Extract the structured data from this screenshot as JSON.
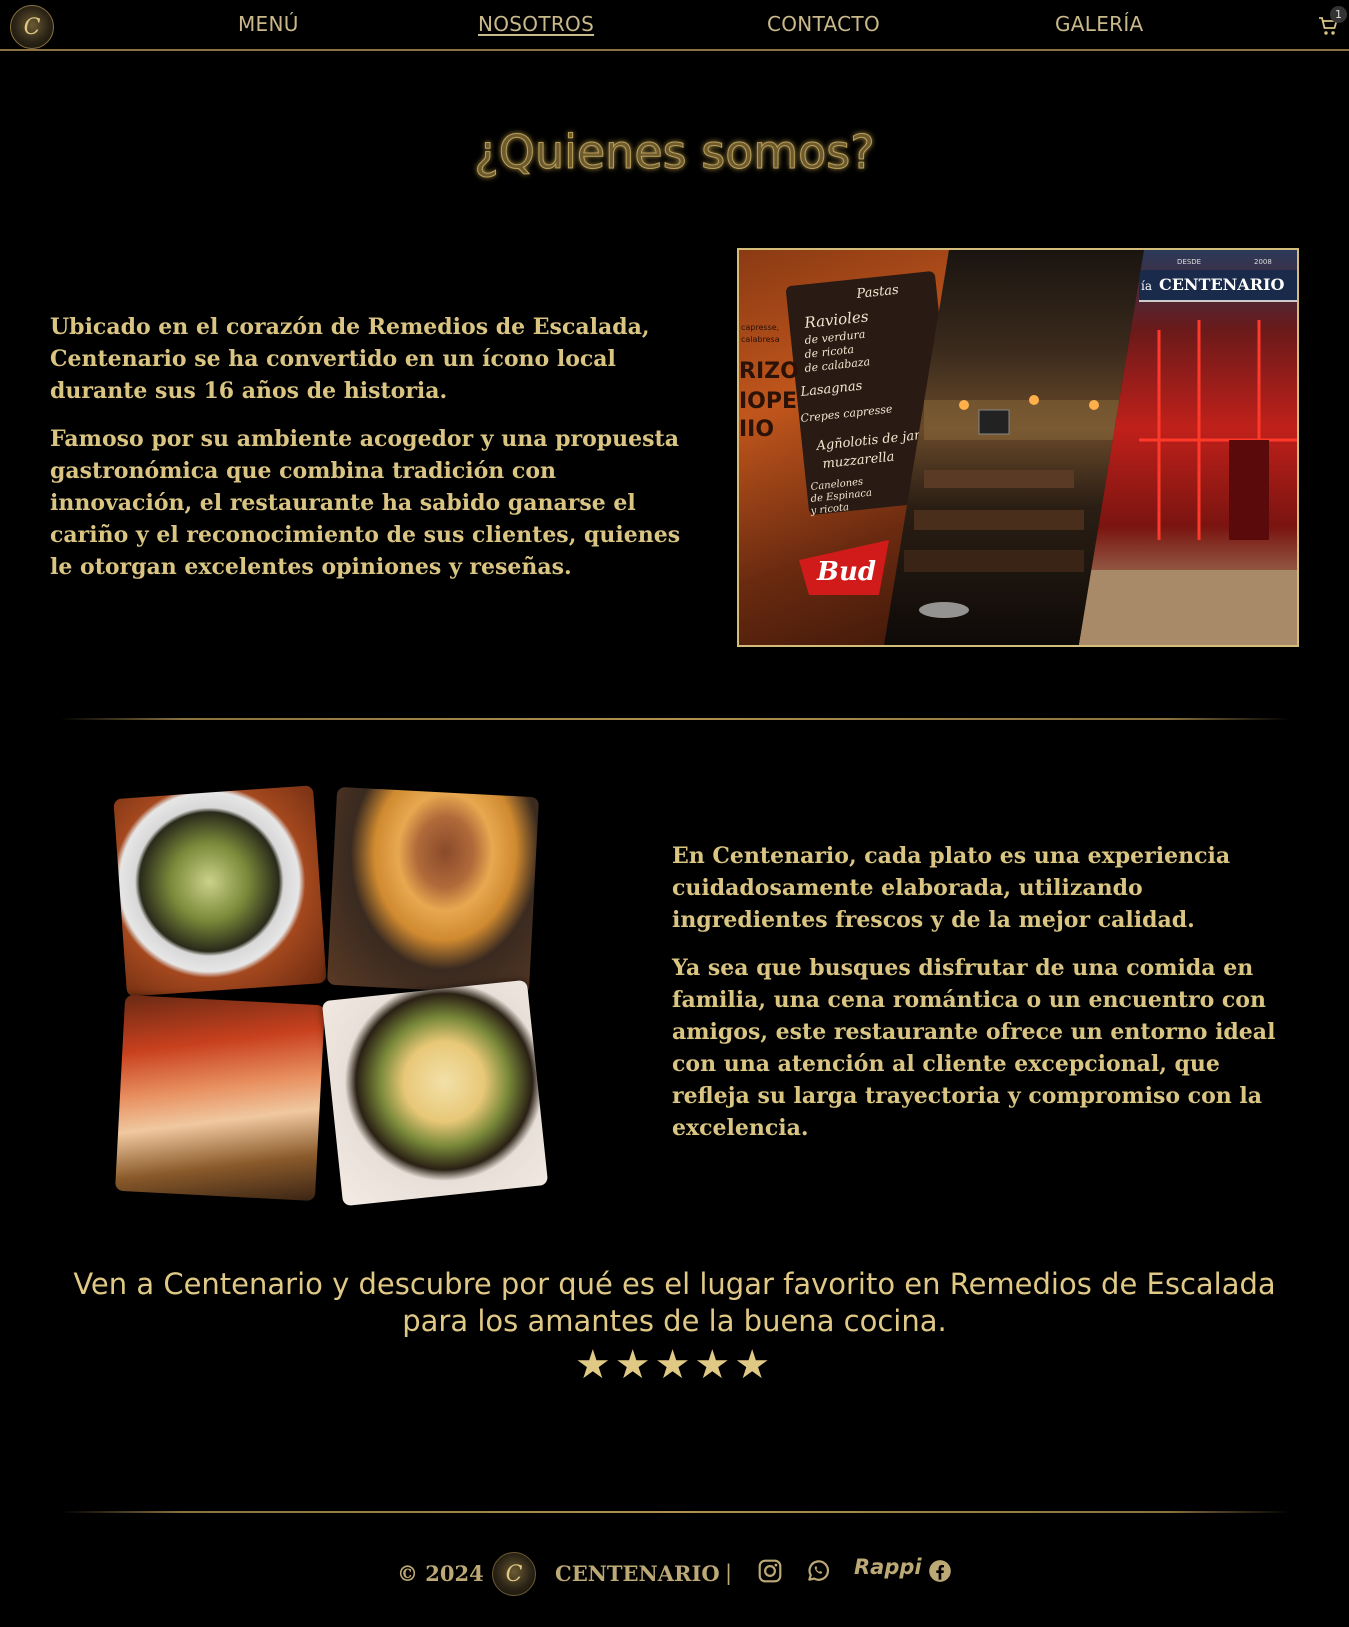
{
  "nav": {
    "logo_letter": "C",
    "links": [
      "MENÚ",
      "NOSOTROS",
      "CONTACTO",
      "GALERÍA"
    ],
    "active": "NOSOTROS",
    "cart_count": "1"
  },
  "about": {
    "title": "¿Quienes somos?",
    "block1": {
      "p1": "Ubicado en el corazón de Remedios de Escalada, Centenario se ha convertido en un ícono local durante sus 16 años de historia.",
      "p2": "Famoso por su ambiente acogedor y una propuesta gastronómica que combina tradición con innovación, el restaurante ha sabido ganarse el cariño y el reconocimiento de sus clientes, quienes le otorgan excelentes opiniones y reseñas."
    },
    "block2": {
      "p1": "En Centenario, cada plato es una experiencia cuidadosamente elaborada, utilizando ingredientes frescos y de la mejor calidad.",
      "p2": "Ya sea que busques disfrutar de una comida en familia, una cena romántica o un encuentro con amigos, este restaurante ofrece un entorno ideal con una atención al cliente excepcional, que refleja su larga trayectoria y compromiso con la excelencia."
    },
    "closing": "Ven a Centenario y descubre por qué es el lugar favorito en Remedios de Escalada para los amantes de la buena cocina.",
    "rating": 5,
    "stars": "★★★★★"
  },
  "collage1": {
    "chalkboard_lines": [
      "Pastas",
      "Ravioles",
      "de verdura",
      "de ricota",
      "de calabaza",
      "Lasagnas",
      "Crepes capresse",
      "Agñolotis de jamón",
      "muzzarella",
      "Canelones",
      "de Espinaca",
      "y ricota"
    ],
    "side_text": [
      "capresse,",
      "calabresa",
      "RIZO",
      "IOPE",
      "IIO"
    ],
    "sign_text": "Bud",
    "storefront_sign": "CENTENARIO",
    "storefront_small": [
      "DESDE",
      "2008"
    ],
    "storefront_label": "ía"
  },
  "footer": {
    "copyright": "© 2024",
    "brand": "CENTENARIO",
    "divider": "|",
    "rappi": "Rappi"
  },
  "colors": {
    "gold": "#e0c885",
    "background": "#000000"
  }
}
